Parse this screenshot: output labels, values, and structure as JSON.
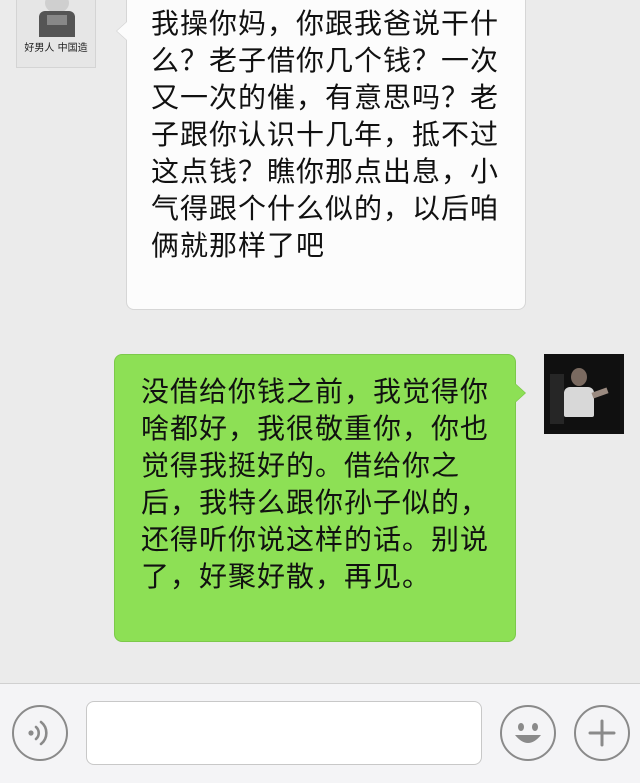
{
  "contact": {
    "avatar_caption": "好男人 中国造"
  },
  "messages": [
    {
      "side": "left",
      "text": "我操你妈，你跟我爸说干什么？老子借你几个钱？一次又一次的催，有意思吗？老子跟你认识十几年，抵不过这点钱？瞧你那点出息，小气得跟个什么似的，以后咱俩就那样了吧"
    },
    {
      "side": "right",
      "text": "没借给你钱之前，我觉得你啥都好，我很敬重你，你也觉得我挺好的。借给你之后，我特么跟你孙子似的，还得听你说这样的话。别说了，好聚好散，再见。"
    }
  ],
  "input_bar": {
    "text_value": "",
    "voice_icon": "voice-icon",
    "emoji_icon": "emoji-icon",
    "plus_icon": "plus-icon"
  },
  "colors": {
    "chat_background": "#ebebeb",
    "incoming_bubble": "#fcfcfc",
    "outgoing_bubble": "#8de055",
    "input_bar_background": "#f4f4f6"
  }
}
